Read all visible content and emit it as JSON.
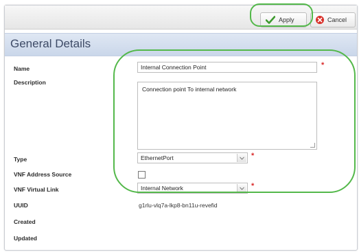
{
  "toolbar": {
    "apply_label": "Apply",
    "cancel_label": "Cancel"
  },
  "section": {
    "title": "General Details"
  },
  "form": {
    "name": {
      "label": "Name",
      "value": "Internal Connection Point",
      "required_mark": "*"
    },
    "description": {
      "label": "Description",
      "value": "Connection point To internal network"
    },
    "type": {
      "label": "Type",
      "value": "EthernetPort",
      "required_mark": "*"
    },
    "vnf_address_source": {
      "label": "VNF Address Source",
      "checked": false
    },
    "vnf_virtual_link": {
      "label": "VNF Virtual Link",
      "value": "Internal Network",
      "required_mark": "*"
    },
    "uuid": {
      "label": "UUID",
      "value": "g1rlu-vlq7a-lkp8-bn11u-revefid"
    },
    "created": {
      "label": "Created"
    },
    "updated": {
      "label": "Updated"
    }
  },
  "colors": {
    "highlight": "#53b84a",
    "required": "#d92a2a",
    "section_bg": "#d4deee",
    "title_text": "#3d4a66"
  }
}
